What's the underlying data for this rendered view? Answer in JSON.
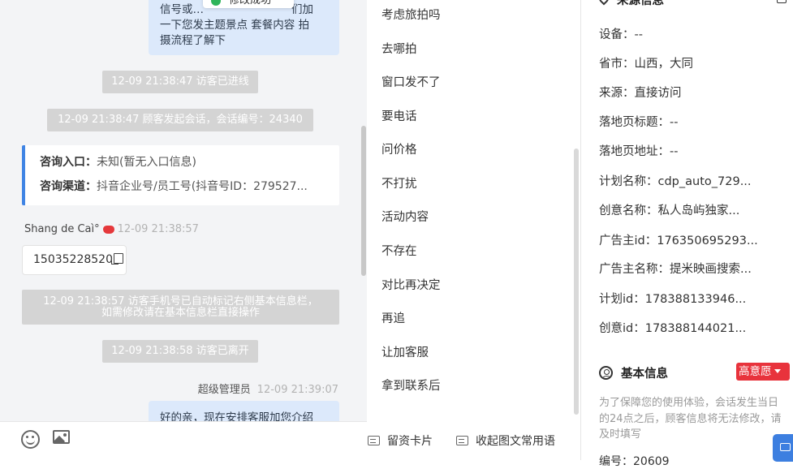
{
  "chat": {
    "top_message_lines": [
      "信号或…",
      "一下您发主题景点 套餐内容 拍",
      "摄流程了解下"
    ],
    "top_message_fragment": "们加",
    "toast": "修改成功",
    "system_messages": [
      "12-09 21:38:47 访客已进线",
      "12-09 21:38:47 顾客发起会话，会话编号：24340",
      "12-09 21:38:58 访客已离开"
    ],
    "phone_notice_lines": [
      "12-09 21:38:57 访客手机号已自动标记右侧基本信息栏，",
      "如需修改请在基本信息栏直接操作"
    ],
    "info_card": {
      "entry_label": "咨询入口：",
      "entry_value": "未知(暂无入口信息)",
      "channel_label": "咨询渠道：",
      "channel_value": "抖音企业号/员工号(抖音号ID：279527..."
    },
    "visitor": {
      "name": "Shang de Caì°",
      "time": "12-09 21:38:57",
      "phone": "15035228520"
    },
    "agent": {
      "name": "超级管理员",
      "time": "12-09 21:39:07",
      "message": "好的亲，现在安排客服加您介绍"
    }
  },
  "quick_replies": [
    "考虑旅拍吗",
    "去哪拍",
    "窗口发不了",
    "要电话",
    "问价格",
    "不打扰",
    "活动内容",
    "不存在",
    "对比再决定",
    "再追",
    "让加客服",
    "拿到联系后"
  ],
  "quick_bottom": {
    "card_button": "留资卡片",
    "collapse_button": "收起图文常用语"
  },
  "panel": {
    "source_title": "来源信息",
    "fields": [
      {
        "label": "设备：",
        "value": "--"
      },
      {
        "label": "省市：",
        "value": "山西，大同"
      },
      {
        "label": "来源：",
        "value": "直接访问"
      },
      {
        "label": "落地页标题：",
        "value": "--"
      },
      {
        "label": "落地页地址：",
        "value": "--"
      },
      {
        "label": "计划名称：",
        "value": "cdp_auto_729..."
      },
      {
        "label": "创意名称：",
        "value": "私人岛屿独家..."
      },
      {
        "label": "广告主id：",
        "value": "176350695293..."
      },
      {
        "label": "广告主名称：",
        "value": "提米映画搜索..."
      },
      {
        "label": "计划id：",
        "value": "178388133946..."
      },
      {
        "label": "创意id：",
        "value": "178388144021..."
      }
    ],
    "basic_title": "基本信息",
    "intent_badge": "高意愿",
    "notice": "为了保障您的使用体验，会话发生当日的24点之后，顾客信息将无法修改，请及时填写",
    "cut_off_field": "编号：20609"
  },
  "colors": {
    "accent_blue": "#3f84e4",
    "bubble_blue": "#dce9fb",
    "badge_red": "#e8333c",
    "system_gray": "#d4d4d4"
  }
}
